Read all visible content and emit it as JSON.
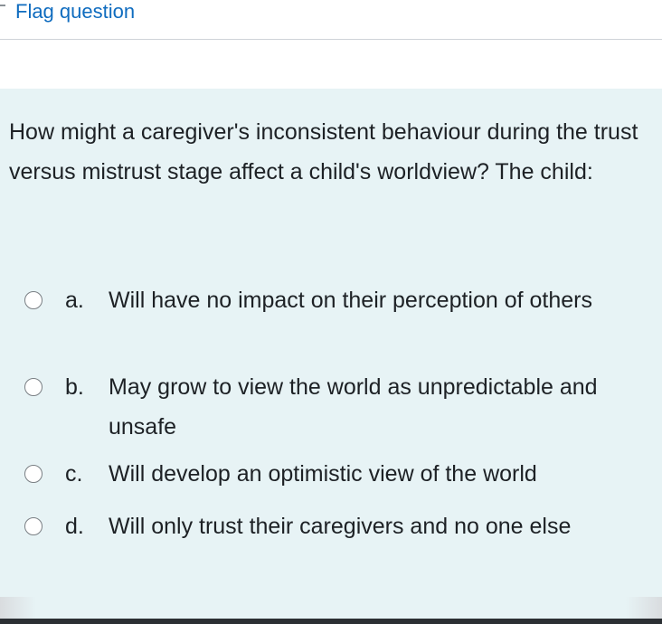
{
  "flag": {
    "label": "Flag question"
  },
  "question": {
    "text": "How might a caregiver's inconsistent behaviour during the trust versus mistrust stage affect a child's worldview? The child:",
    "answers": [
      {
        "letter": "a.",
        "text": "Will have no impact on their perception of others"
      },
      {
        "letter": "b.",
        "text": "May grow to view the world as unpredictable and unsafe"
      },
      {
        "letter": "c.",
        "text": "Will develop an optimistic view of the world"
      },
      {
        "letter": "d.",
        "text": "Will only trust their caregivers and no one else"
      }
    ]
  },
  "colors": {
    "link": "#0f6cbf",
    "panel_background": "#e7f3f5",
    "text": "#1d2125"
  },
  "icons": {
    "radio": "radio-unselected-icon"
  }
}
